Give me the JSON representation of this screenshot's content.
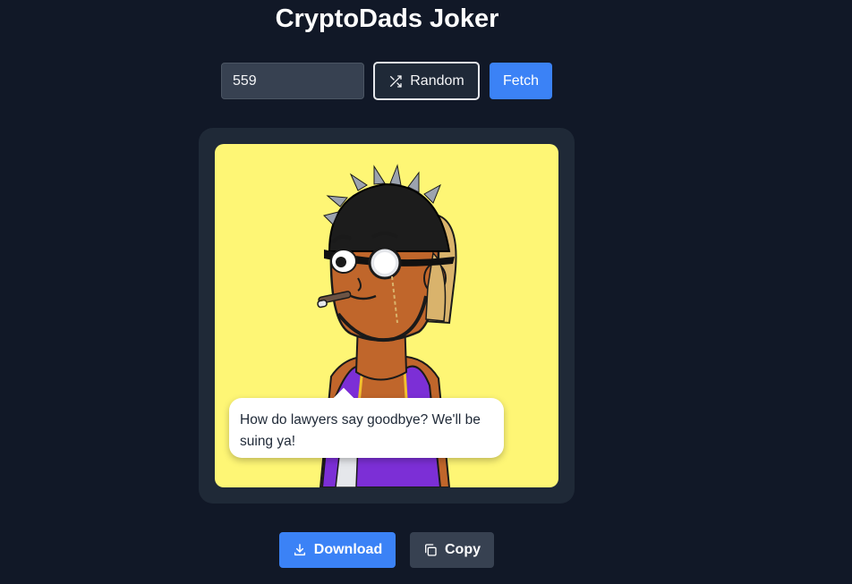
{
  "header": {
    "title": "CryptoDads Joker"
  },
  "controls": {
    "token_id_value": "559",
    "random_label": "Random",
    "random_icon": "shuffle-icon",
    "fetch_label": "Fetch"
  },
  "card": {
    "background_color": "#fef675",
    "joke": "How do lawyers say goodbye? We'll be suing ya!"
  },
  "actions": {
    "download_label": "Download",
    "download_icon": "download-icon",
    "copy_label": "Copy",
    "copy_icon": "copy-icon"
  },
  "colors": {
    "page_background": "#111827",
    "card_background": "#1f2937",
    "accent": "#3b82f6",
    "secondary_button": "#374151"
  }
}
